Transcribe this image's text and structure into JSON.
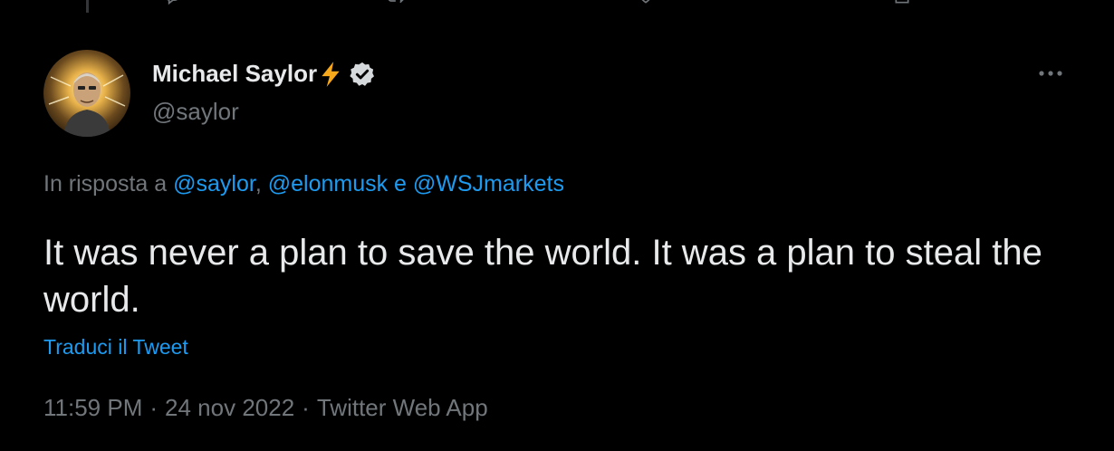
{
  "colors": {
    "background": "#000000",
    "text_primary": "#e7e9ea",
    "text_secondary": "#71767b",
    "link": "#1d9bf0",
    "bolt": "#f7a81b"
  },
  "top_actions": {
    "icons": [
      "reply-icon",
      "retweet-icon",
      "like-icon",
      "share-icon"
    ]
  },
  "author": {
    "name": "Michael Saylor",
    "emoji_icon": "lightning-bolt-icon",
    "badge_icon": "verified-badge-icon",
    "handle": "@saylor"
  },
  "more_menu": {
    "icon": "more-options-icon"
  },
  "reply_context": {
    "prefix": "In risposta a ",
    "mention_1": "@saylor",
    "comma": ", ",
    "mention_2": "@elonmusk",
    "conjunction": " e ",
    "mention_3": "@WSJmarkets"
  },
  "tweet": {
    "text": "It was never a plan to save the world. It was a plan to steal the world."
  },
  "translate": {
    "label": "Traduci il Tweet"
  },
  "meta": {
    "time": "11:59 PM",
    "separator": "·",
    "date": "24 nov 2022",
    "source": "Twitter Web App"
  }
}
